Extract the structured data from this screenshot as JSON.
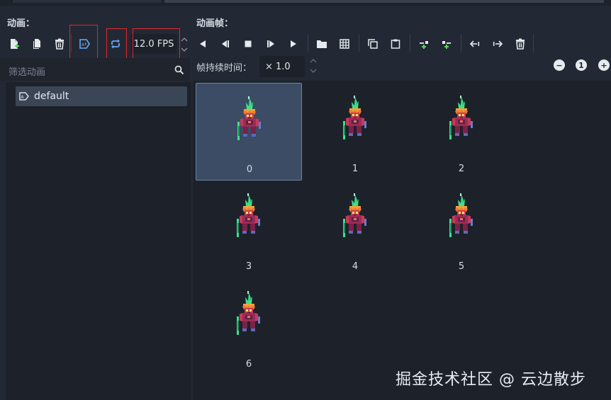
{
  "animations_panel": {
    "title": "动画：",
    "filter_placeholder": "筛选动画",
    "fps_value": "12.0 FPS",
    "items": [
      {
        "label": "default",
        "icon": "animation-tag-icon"
      }
    ]
  },
  "frames_panel": {
    "title": "动画帧：",
    "duration_label": "帧持续时间：",
    "duration_value": "× 1.0",
    "zoom_reset_label": "1",
    "frames": [
      {
        "index": "0",
        "selected": true
      },
      {
        "index": "1"
      },
      {
        "index": "2"
      },
      {
        "index": "3"
      },
      {
        "index": "4"
      },
      {
        "index": "5"
      },
      {
        "index": "6"
      }
    ]
  },
  "watermark": "掘金技术社区 @ 云边散步",
  "colors": {
    "background": "#232934",
    "panel": "#1d222a",
    "selected_frame": "#3b4c64",
    "accent_blue": "#5b9bf0",
    "highlight_red": "#e0262c"
  }
}
